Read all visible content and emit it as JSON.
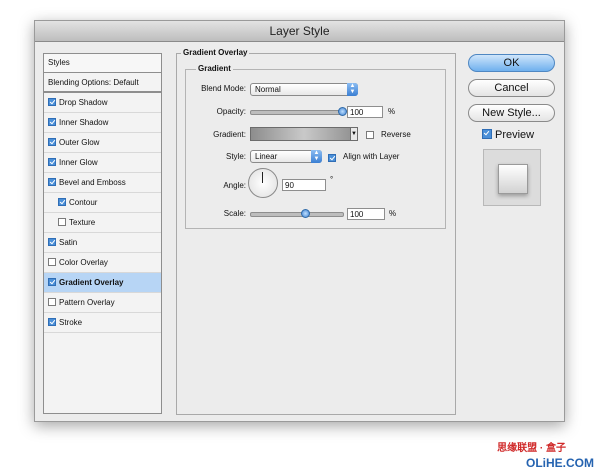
{
  "window": {
    "title": "Layer Style"
  },
  "styles_panel": {
    "header": "Styles",
    "blending": "Blending Options: Default",
    "items": [
      {
        "label": "Drop Shadow",
        "checked": true
      },
      {
        "label": "Inner Shadow",
        "checked": true
      },
      {
        "label": "Outer Glow",
        "checked": true
      },
      {
        "label": "Inner Glow",
        "checked": true
      },
      {
        "label": "Bevel and Emboss",
        "checked": true
      },
      {
        "label": "Contour",
        "checked": true
      },
      {
        "label": "Texture",
        "checked": false
      },
      {
        "label": "Satin",
        "checked": true
      },
      {
        "label": "Color Overlay",
        "checked": false
      },
      {
        "label": "Gradient Overlay",
        "checked": true
      },
      {
        "label": "Pattern Overlay",
        "checked": false
      },
      {
        "label": "Stroke",
        "checked": true
      }
    ]
  },
  "gradient_overlay": {
    "section_title": "Gradient Overlay",
    "group_title": "Gradient",
    "blend_mode_label": "Blend Mode:",
    "blend_mode_value": "Normal",
    "opacity_label": "Opacity:",
    "opacity_value": "100",
    "opacity_unit": "%",
    "gradient_label": "Gradient:",
    "reverse_label": "Reverse",
    "reverse_checked": false,
    "style_label": "Style:",
    "style_value": "Linear",
    "align_label": "Align with Layer",
    "align_checked": true,
    "angle_label": "Angle:",
    "angle_value": "90",
    "angle_unit": "°",
    "scale_label": "Scale:",
    "scale_value": "100",
    "scale_unit": "%"
  },
  "buttons": {
    "ok": "OK",
    "cancel": "Cancel",
    "new_style": "New Style...",
    "preview": "Preview",
    "preview_checked": true
  },
  "watermark": {
    "logo_text": "OLiHE.COM",
    "sub_text": "思缘联盟 · 盒子"
  },
  "colors": {
    "accent": "#4a8fd8",
    "selected_row": "#b7d5f5"
  }
}
